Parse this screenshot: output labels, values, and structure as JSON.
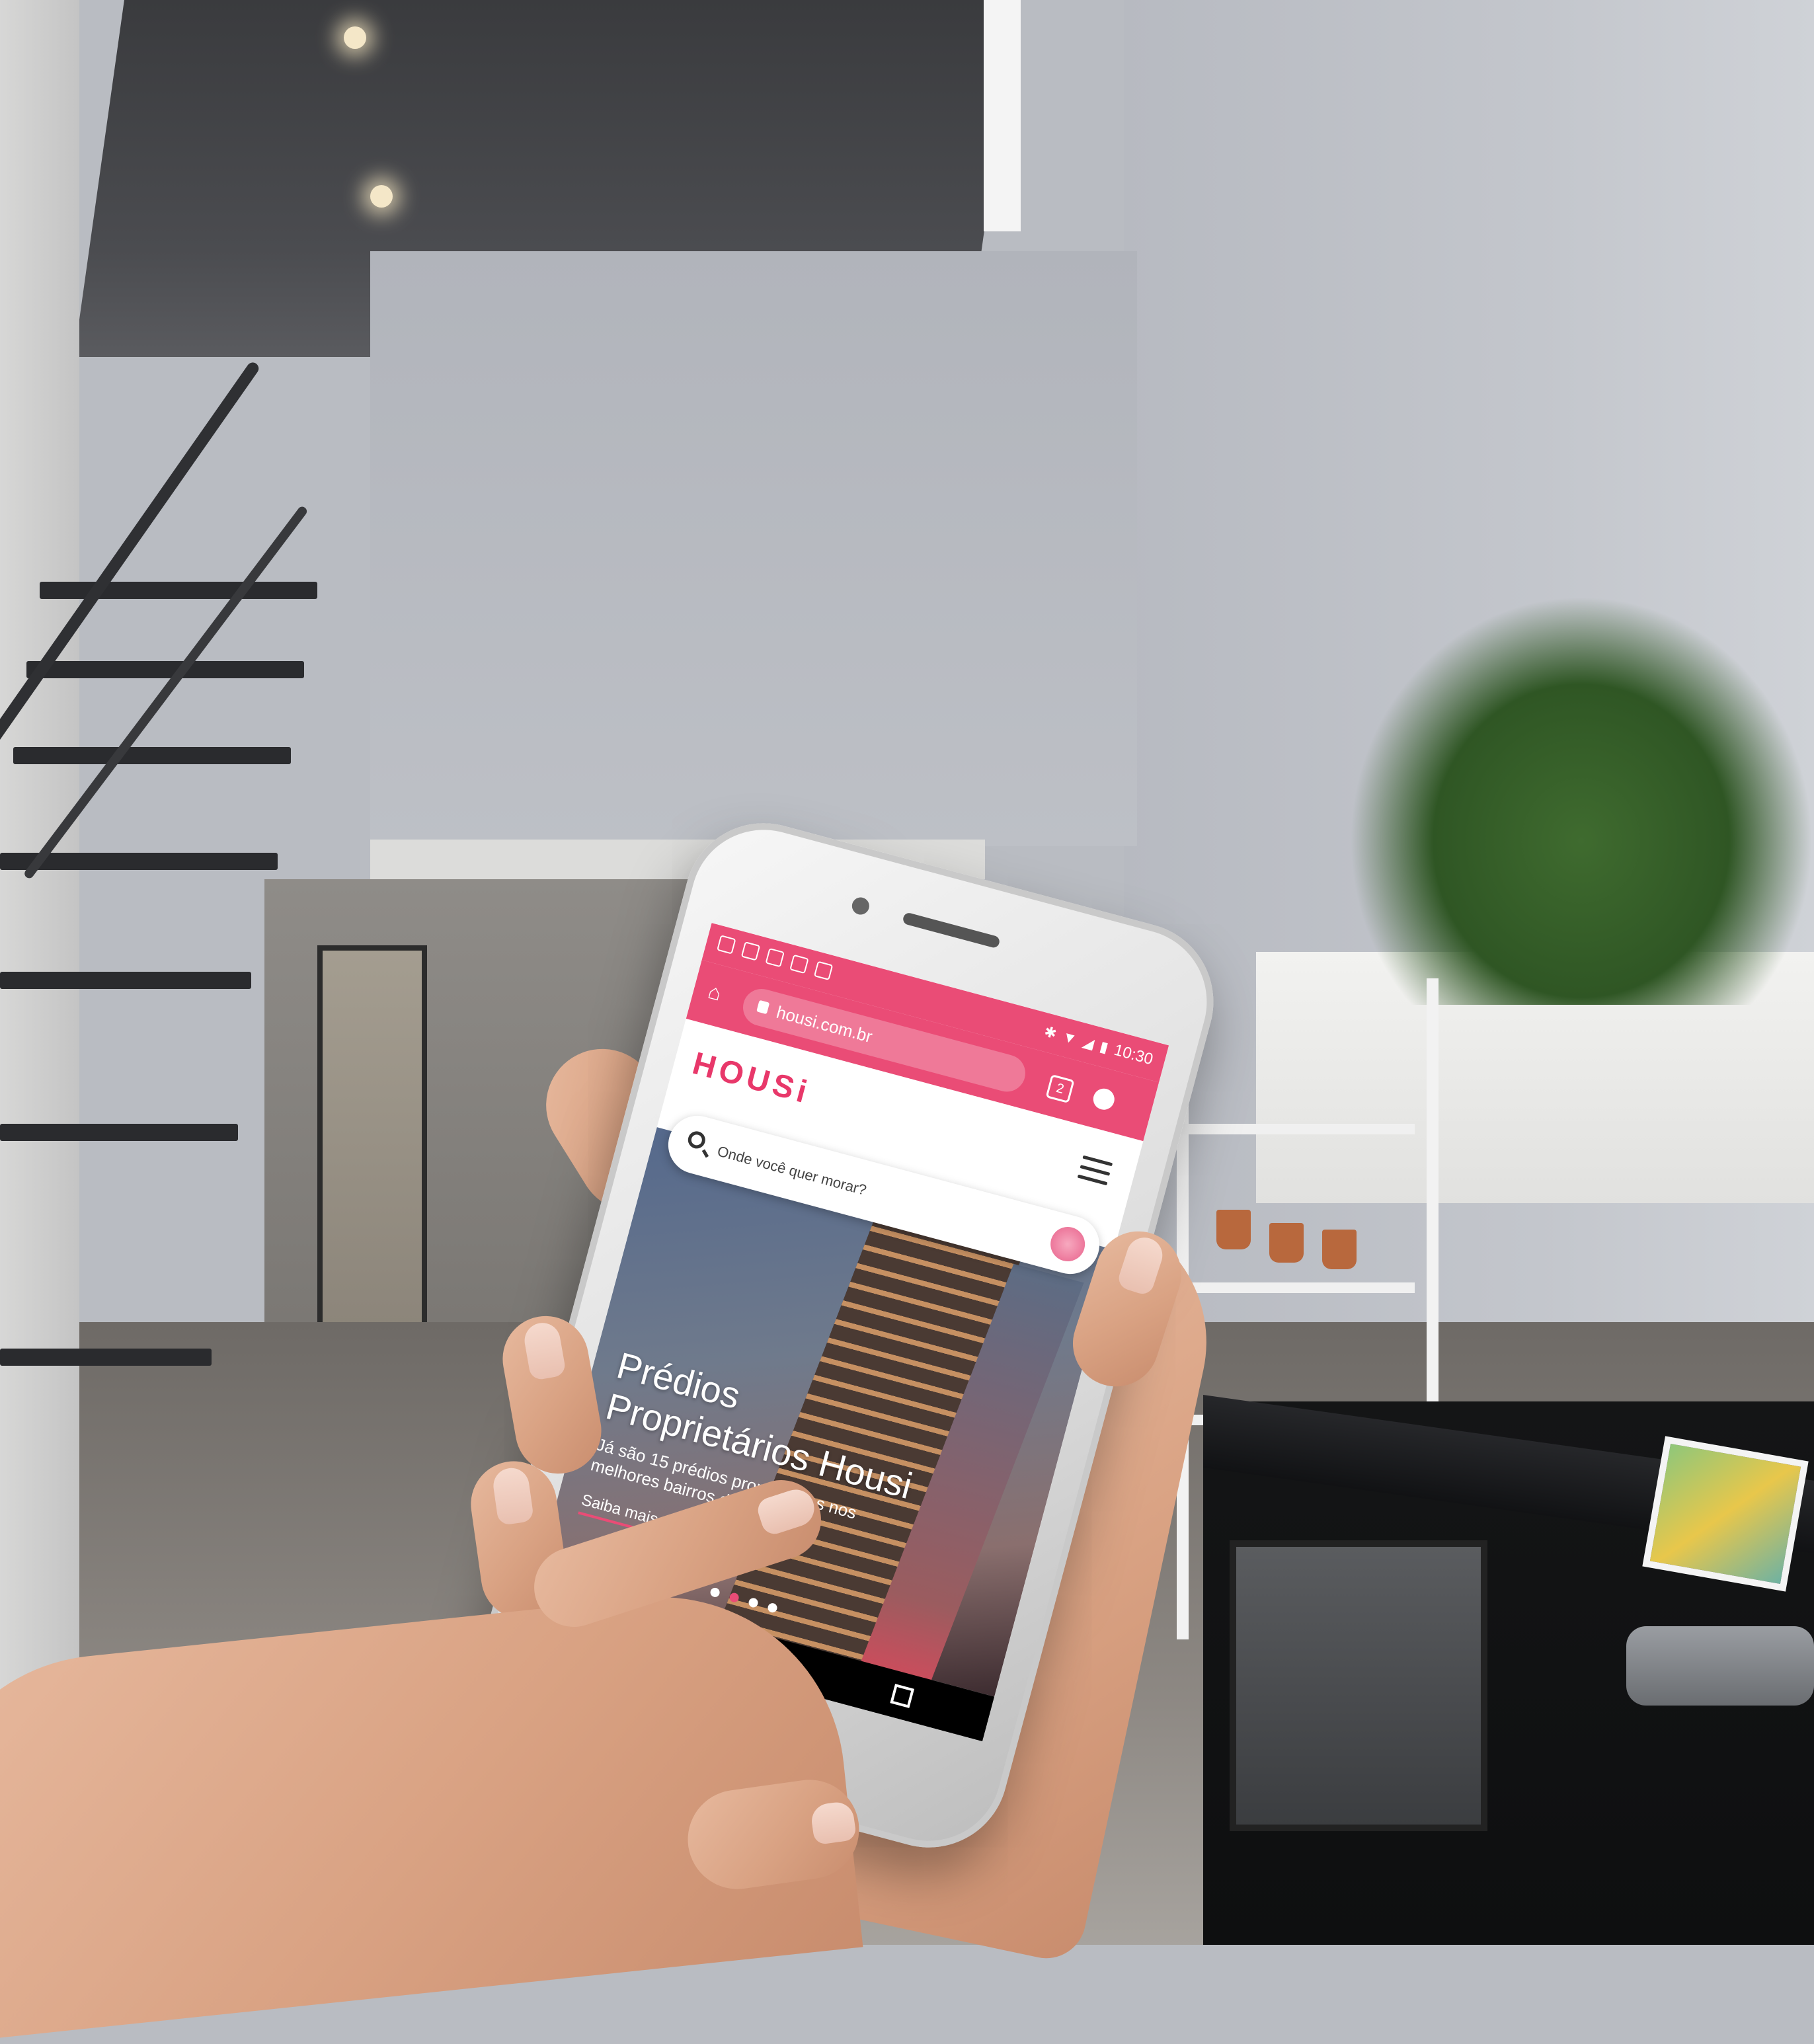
{
  "browser": {
    "status_time": "10:30",
    "url": "housi.com.br",
    "tab_count": "2"
  },
  "site": {
    "logo": "HOUSi",
    "search": {
      "placeholder": "Onde você quer morar?"
    },
    "hero": {
      "title_line1": "Prédios",
      "title_line2": "Proprietários Housi",
      "subtitle": "Já são 15 prédios proprietários nos melhores bairros de SP",
      "link": "Saiba mais",
      "slides_total": 4,
      "active_slide": 2
    }
  },
  "colors": {
    "brand": "#ea4c76"
  }
}
